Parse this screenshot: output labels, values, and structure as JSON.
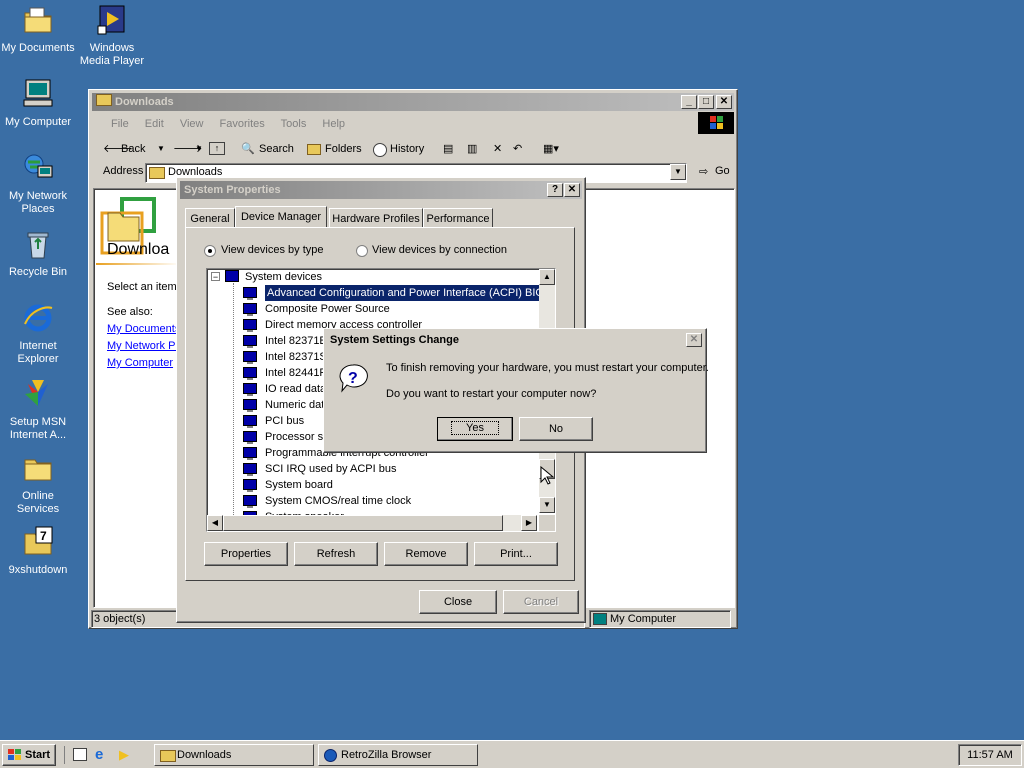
{
  "desktop": {
    "icons": [
      {
        "label": "My Documents",
        "icon": "folder-documents-icon"
      },
      {
        "label": "Windows Media Player",
        "icon": "media-player-icon"
      },
      {
        "label": "My Computer",
        "icon": "computer-icon"
      },
      {
        "label": "My Network Places",
        "icon": "network-icon"
      },
      {
        "label": "Recycle Bin",
        "icon": "recycle-bin-icon"
      },
      {
        "label": "Internet Explorer",
        "icon": "internet-explorer-icon"
      },
      {
        "label": "Setup MSN Internet A...",
        "icon": "msn-icon"
      },
      {
        "label": "Online Services",
        "icon": "folder-icon"
      },
      {
        "label": "9xshutdown",
        "icon": "shutdown-icon"
      }
    ]
  },
  "explorer": {
    "title": "Downloads",
    "menu": [
      "File",
      "Edit",
      "View",
      "Favorites",
      "Tools",
      "Help"
    ],
    "toolbar": {
      "back": "Back",
      "search": "Search",
      "folders": "Folders",
      "history": "History"
    },
    "address_label": "Address",
    "address_value": "Downloads",
    "go_label": "Go",
    "panel_title": "Downloa",
    "select_prompt": "Select an item",
    "see_also": "See also:",
    "links": [
      "My Documents",
      "My Network Pl",
      "My Computer"
    ],
    "status_left": "3 object(s)",
    "status_right": "My Computer"
  },
  "sysprops": {
    "title": "System Properties",
    "tabs": [
      "General",
      "Device Manager",
      "Hardware Profiles",
      "Performance"
    ],
    "radio_type": "View devices by type",
    "radio_connection": "View devices by connection",
    "tree_root": "System devices",
    "devices": [
      "Advanced Configuration and Power Interface (ACPI) BIOS",
      "Composite Power Source",
      "Direct memory access controller",
      "Intel 82371E",
      "Intel 82371S",
      "Intel 82441F",
      "IO read data",
      "Numeric dat",
      "PCI bus",
      "Processor su",
      "Programmable interrupt controller",
      "SCI IRQ used by ACPI bus",
      "System board",
      "System CMOS/real time clock",
      "System speaker"
    ],
    "buttons": {
      "properties": "Properties",
      "refresh": "Refresh",
      "remove": "Remove",
      "print": "Print..."
    },
    "close": "Close",
    "cancel": "Cancel"
  },
  "dialog": {
    "title": "System Settings Change",
    "line1": "To finish removing your hardware, you must restart your computer.",
    "line2": "Do you want to restart your computer now?",
    "yes": "Yes",
    "no": "No"
  },
  "taskbar": {
    "start": "Start",
    "tasks": [
      "Downloads",
      "RetroZilla Browser"
    ],
    "clock": "11:57 AM"
  },
  "colors": {
    "desktop": "#3a6ea5",
    "title_active": "#0a246a",
    "selection": "#0a246a",
    "face": "#d4d0c8"
  }
}
